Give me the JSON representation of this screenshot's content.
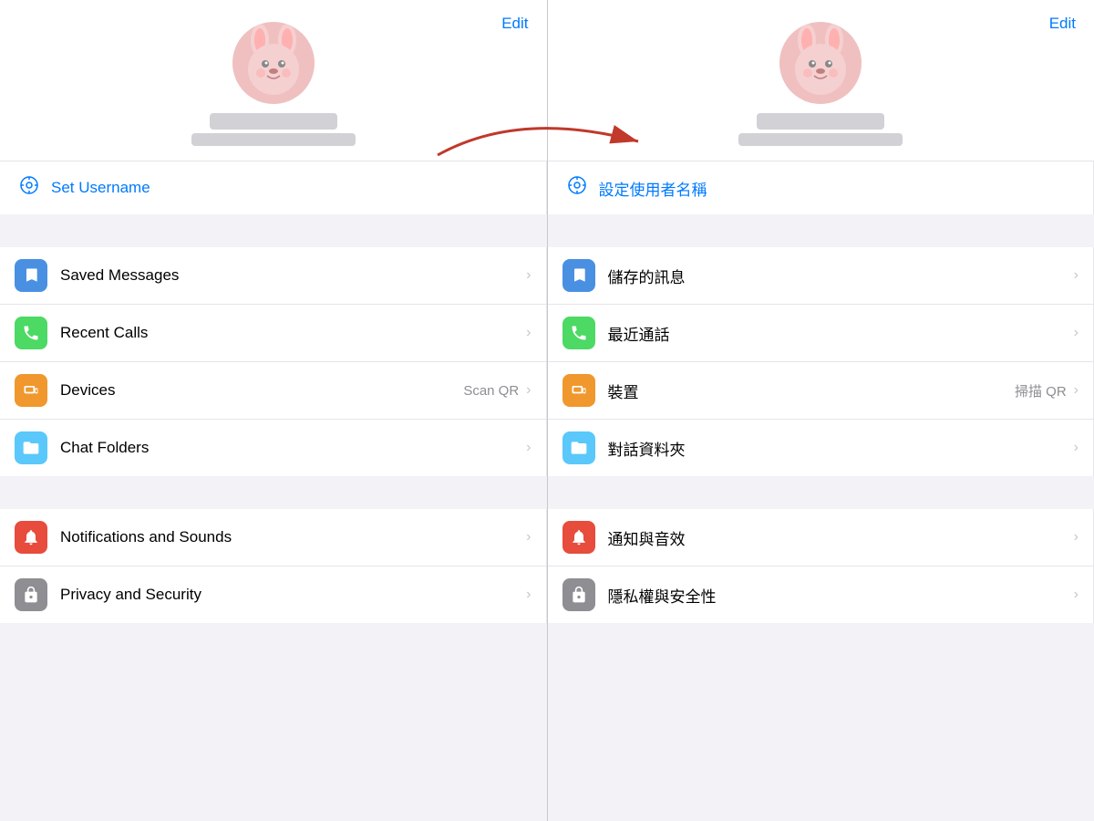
{
  "left": {
    "edit_label": "Edit",
    "username_icon": "⊕",
    "username_label": "Set Username",
    "menu_items": [
      {
        "icon": "bookmark",
        "icon_class": "icon-blue",
        "label": "Saved Messages",
        "sub": "",
        "chevron": "›"
      },
      {
        "icon": "phone",
        "icon_class": "icon-green",
        "label": "Recent Calls",
        "sub": "",
        "chevron": "›"
      },
      {
        "icon": "devices",
        "icon_class": "icon-orange",
        "label": "Devices",
        "sub": "Scan QR",
        "chevron": "›"
      },
      {
        "icon": "folder",
        "icon_class": "icon-teal",
        "label": "Chat Folders",
        "sub": "",
        "chevron": "›"
      }
    ],
    "menu_items2": [
      {
        "icon": "bell",
        "icon_class": "icon-red",
        "label": "Notifications and Sounds",
        "sub": "",
        "chevron": "›"
      },
      {
        "icon": "lock",
        "icon_class": "icon-gray",
        "label": "Privacy and Security",
        "sub": "",
        "chevron": "›"
      }
    ]
  },
  "right": {
    "edit_label": "Edit",
    "username_icon": "⊕",
    "username_label": "設定使用者名稱",
    "menu_items": [
      {
        "icon": "bookmark",
        "icon_class": "icon-blue",
        "label": "儲存的訊息",
        "sub": "",
        "chevron": "›"
      },
      {
        "icon": "phone",
        "icon_class": "icon-green",
        "label": "最近通話",
        "sub": "",
        "chevron": "›"
      },
      {
        "icon": "devices",
        "icon_class": "icon-orange",
        "label": "裝置",
        "sub": "掃描 QR",
        "chevron": "›"
      },
      {
        "icon": "folder",
        "icon_class": "icon-teal",
        "label": "對話資料夾",
        "sub": "",
        "chevron": "›"
      }
    ],
    "menu_items2": [
      {
        "icon": "bell",
        "icon_class": "icon-red",
        "label": "通知與音效",
        "sub": "",
        "chevron": "›"
      },
      {
        "icon": "lock",
        "icon_class": "icon-gray",
        "label": "隱私權與安全性",
        "sub": "",
        "chevron": "›"
      }
    ]
  }
}
